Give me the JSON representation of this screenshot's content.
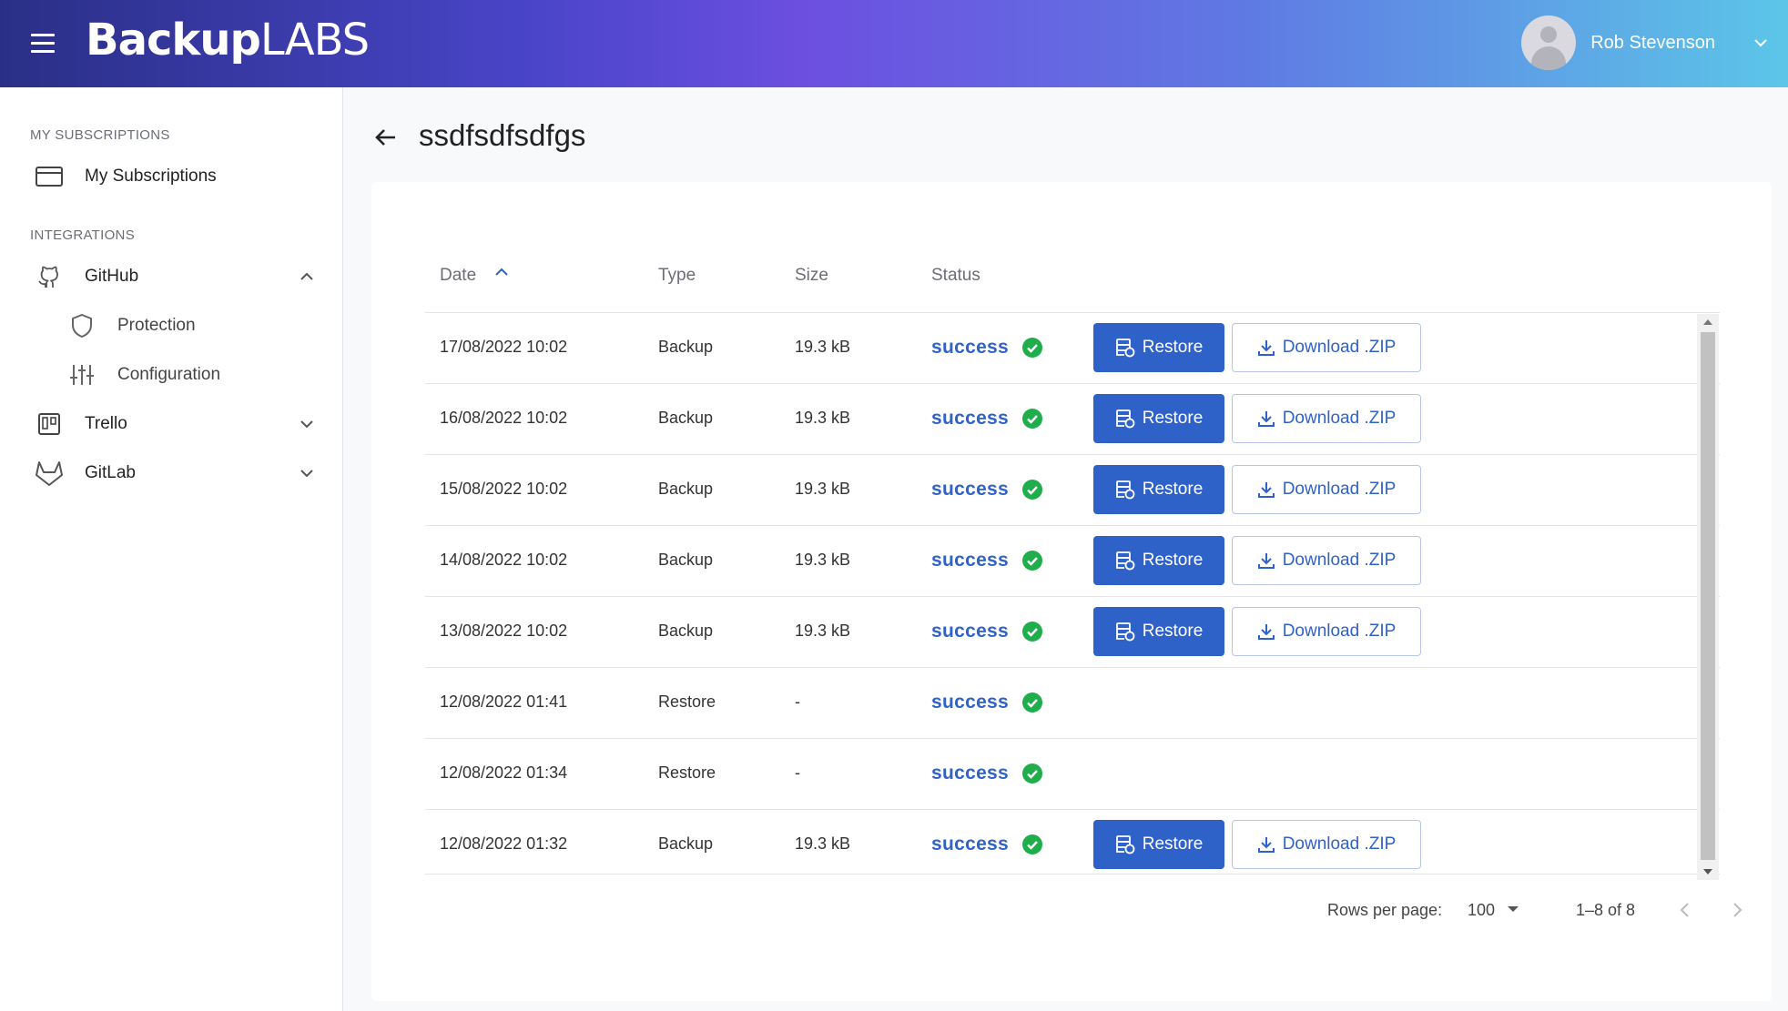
{
  "header": {
    "logo_bold": "Backup",
    "logo_light": "LABS",
    "user_name": "Rob Stevenson"
  },
  "sidebar": {
    "section_subscriptions": "MY SUBSCRIPTIONS",
    "my_subscriptions": "My Subscriptions",
    "section_integrations": "INTEGRATIONS",
    "github": "GitHub",
    "protection": "Protection",
    "configuration": "Configuration",
    "trello": "Trello",
    "gitlab": "GitLab"
  },
  "page": {
    "title": "ssdfsdfsdfgs"
  },
  "table": {
    "columns": {
      "date": "Date",
      "type": "Type",
      "size": "Size",
      "status": "Status"
    },
    "restore_label": "Restore",
    "download_label": "Download .ZIP",
    "rows": [
      {
        "date": "17/08/2022 10:02",
        "type": "Backup",
        "size": "19.3 kB",
        "status": "success"
      },
      {
        "date": "16/08/2022 10:02",
        "type": "Backup",
        "size": "19.3 kB",
        "status": "success"
      },
      {
        "date": "15/08/2022 10:02",
        "type": "Backup",
        "size": "19.3 kB",
        "status": "success"
      },
      {
        "date": "14/08/2022 10:02",
        "type": "Backup",
        "size": "19.3 kB",
        "status": "success"
      },
      {
        "date": "13/08/2022 10:02",
        "type": "Backup",
        "size": "19.3 kB",
        "status": "success"
      },
      {
        "date": "12/08/2022 01:41",
        "type": "Restore",
        "size": "-",
        "status": "success"
      },
      {
        "date": "12/08/2022 01:34",
        "type": "Restore",
        "size": "-",
        "status": "success"
      },
      {
        "date": "12/08/2022 01:32",
        "type": "Backup",
        "size": "19.3 kB",
        "status": "success"
      }
    ]
  },
  "pagination": {
    "rows_per_page_label": "Rows per page:",
    "rows_per_page_value": "100",
    "range": "1–8 of 8"
  },
  "colors": {
    "primary": "#2f62c8",
    "success": "#1fae4b",
    "header_start": "#2a2f86",
    "header_end": "#5cc6e8"
  }
}
